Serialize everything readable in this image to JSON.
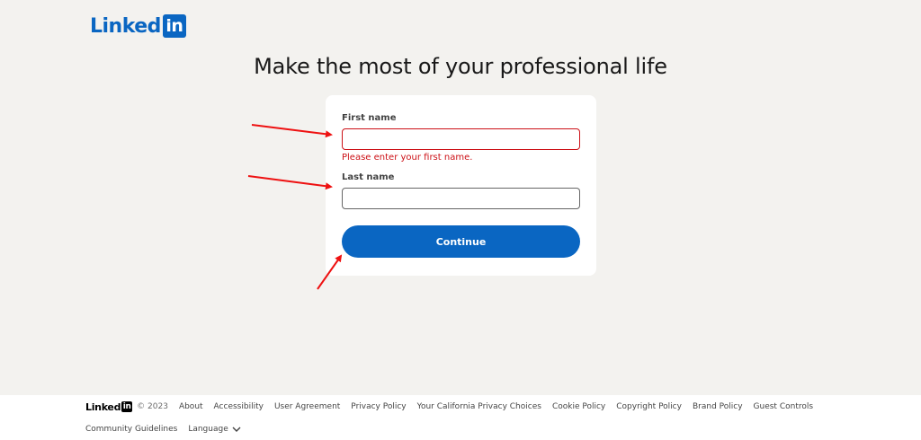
{
  "brand": {
    "word": "Linked",
    "box": "in"
  },
  "headline": "Make the most of your professional life",
  "form": {
    "first_name_label": "First name",
    "first_name_value": "",
    "first_name_error": "Please enter your first name.",
    "last_name_label": "Last name",
    "last_name_value": "",
    "continue_label": "Continue"
  },
  "footer": {
    "copyright": "© 2023",
    "links_row1": [
      "About",
      "Accessibility",
      "User Agreement",
      "Privacy Policy",
      "Your California Privacy Choices",
      "Cookie Policy",
      "Copyright Policy",
      "Brand Policy",
      "Guest Controls"
    ],
    "links_row2": [
      "Community Guidelines"
    ],
    "language_label": "Language"
  },
  "colors": {
    "brand_blue": "#0a66c2",
    "error_red": "#cc1016",
    "annotation_arrow": "#ee1111",
    "page_bg": "#f3f2ef"
  },
  "icons": {
    "language_toggle": "chevron-down-icon"
  }
}
